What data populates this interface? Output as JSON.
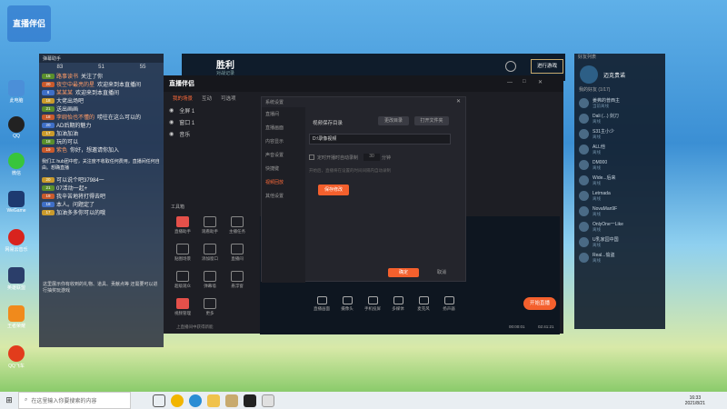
{
  "colors": {
    "accent": "#f4602d",
    "app_bg": "#1d1e24",
    "chat_bg": "#23283c"
  },
  "desktop": {
    "logo_text": "直播伴侣",
    "icons": [
      {
        "label": "此电脑"
      },
      {
        "label": "QQ"
      },
      {
        "label": "微信"
      },
      {
        "label": "WeGame"
      },
      {
        "label": "网易云音乐"
      },
      {
        "label": "英雄联盟"
      },
      {
        "label": "王者荣耀"
      },
      {
        "label": "QQ飞车"
      }
    ]
  },
  "chat": {
    "room_title": "弹幕助手",
    "stats": [
      "83",
      "51",
      "55"
    ],
    "messages": [
      {
        "level": "15",
        "name": "路事读书",
        "text": "关注了你"
      },
      {
        "level": "20",
        "name": "夜空中最亮的星",
        "text": "欢迎来到本直播间"
      },
      {
        "level": "8",
        "name": "某某某",
        "text": "欢迎来到本直播间"
      },
      {
        "level": "18",
        "name": "",
        "text": "大佬出场吧"
      },
      {
        "level": "21",
        "name": "",
        "text": "送出画画"
      },
      {
        "level": "18",
        "name": "李婉怡也不懂的",
        "text": "唠往在这么可以的"
      },
      {
        "level": "20",
        "name": "",
        "text": "AD后期的魅力"
      },
      {
        "level": "17",
        "name": "",
        "text": "加油加油"
      },
      {
        "level": "18",
        "name": "",
        "text": "玩的可以"
      },
      {
        "level": "19",
        "name": "紫色",
        "text": "你好，想邀请你加入"
      },
      {
        "level": "",
        "name": "",
        "text": "我们工 hub团中密，关注度不收取任何费用，直播间任何自由。想确直播"
      },
      {
        "level": "20",
        "name": "",
        "text": "可以说个吧37984一"
      },
      {
        "level": "21",
        "name": "",
        "text": "07活动一起+"
      },
      {
        "level": "19",
        "name": "",
        "text": "我辛苦地将打得去吧"
      },
      {
        "level": "18",
        "name": "",
        "text": "本人。问题定了"
      },
      {
        "level": "17",
        "name": "",
        "text": "加油多多你可以的哦"
      }
    ],
    "footer": "这里展示你有收到的礼物、道具、贡献点等 还需要可以进行抽奖玩游戏"
  },
  "game": {
    "title": "胜利",
    "subtitle": "对战记录",
    "start_button": "进行游戏"
  },
  "friends": {
    "title": "好友列表",
    "my_name": "迈克贵诺",
    "group_label": "我的好友 (1/17)",
    "list": [
      {
        "name": "姜弗的普西主",
        "status": "当前离线"
      },
      {
        "name": "Dali (...) 剑刀",
        "status": "离线"
      },
      {
        "name": "S31主小少",
        "status": "离线"
      },
      {
        "name": "ALL他",
        "status": "离线"
      },
      {
        "name": "DM000",
        "status": "离线"
      },
      {
        "name": "Wide...后来",
        "status": "离线"
      },
      {
        "name": "Letrnada",
        "status": "离线"
      },
      {
        "name": "NovaMan9F",
        "status": "离线"
      },
      {
        "name": "OnlyOne一Like",
        "status": "离线"
      },
      {
        "name": "U乳家园中国",
        "status": "离线"
      },
      {
        "name": "Real...偷盗",
        "status": "离线"
      }
    ]
  },
  "app": {
    "title": "直播伴侣",
    "tabs": [
      "我的场景",
      "互动",
      "可选项"
    ],
    "scenes": [
      "全屏 1",
      "窗口 1",
      "音乐"
    ],
    "tools_label": "工具箱",
    "tools": [
      {
        "label": "直播助手"
      },
      {
        "label": "观看助手"
      },
      {
        "label": "主播任务"
      },
      {
        "label": "贴图场景"
      },
      {
        "label": "添加窗口"
      },
      {
        "label": "直播间"
      },
      {
        "label": "超级观众"
      },
      {
        "label": "弹幕墙"
      },
      {
        "label": "悬浮窗"
      },
      {
        "label": "视频管理"
      },
      {
        "label": "更多"
      }
    ],
    "status_line": "上直播间中获得新能",
    "bottom_controls": [
      "直播画面",
      "摄像头",
      "手机投屏",
      "多媒体",
      "麦克风",
      "扬声器"
    ],
    "start_button": "开始直播",
    "time_a": "00:00:01",
    "time_b": "02:41:21"
  },
  "settings": {
    "title": "系统设置",
    "sidebar": [
      "直播间",
      "直播画面",
      "内容显示",
      "声音设置",
      "快捷键",
      "视频回放",
      "其他设置"
    ],
    "active_index": 5,
    "save_dir_label": "视频保存目录",
    "change_dir_button": "更改目录",
    "open_folder_button": "打开文件夹",
    "path_value": "D:\\录像视频",
    "auto_record_label": "定时开播时自动录制",
    "auto_record_minutes": "30",
    "auto_record_unit": "分钟",
    "hint_text": "开始后，直播将在设置的时间间隔内自动录制",
    "save_button": "保存修改",
    "confirm_button": "确定",
    "cancel_button": "取消"
  },
  "taskbar": {
    "search_placeholder": "在这里输入你要搜索的内容",
    "time": "16:33",
    "date": "2021/8/21"
  }
}
